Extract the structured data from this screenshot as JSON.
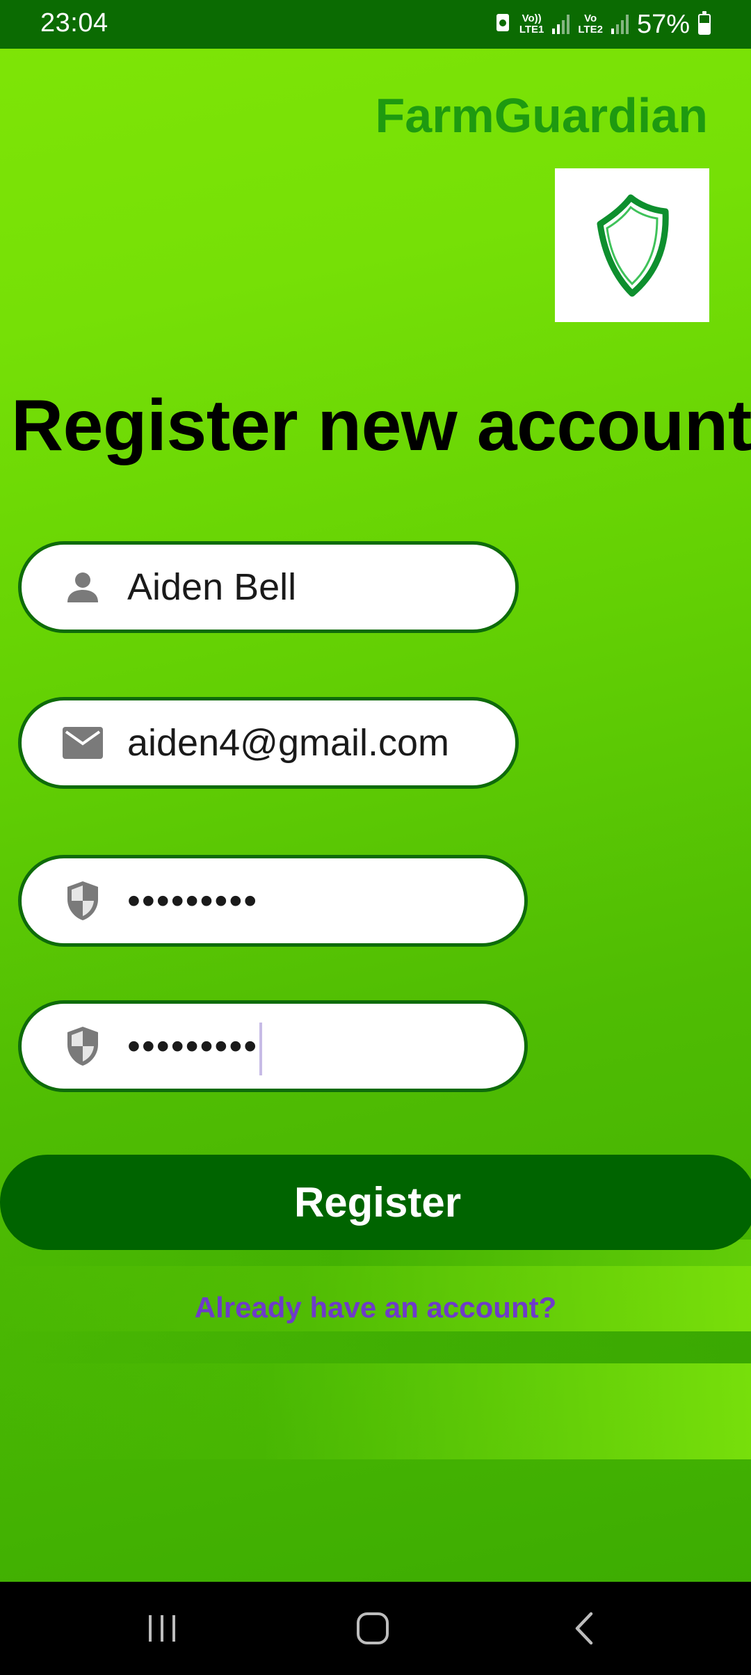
{
  "status_bar": {
    "time": "23:04",
    "sim1_label": "Vo)) LTE1",
    "sim2_label": "Vo LTE2",
    "battery": "57%"
  },
  "app": {
    "title": "FarmGuardian",
    "logo_icon": "green-shield-icon",
    "brand_color": "#1e9a10"
  },
  "page": {
    "heading": "Register new account"
  },
  "form": {
    "name": {
      "icon": "person-icon",
      "value": "Aiden Bell"
    },
    "email": {
      "icon": "mail-icon",
      "value": "aiden4@gmail.com"
    },
    "password": {
      "icon": "security-shield-icon",
      "value": "•••••••••"
    },
    "confirm_password": {
      "icon": "security-shield-icon",
      "value": "•••••••••"
    },
    "field_border_color": "#0e6b0a"
  },
  "actions": {
    "register_label": "Register",
    "register_color": "#006400",
    "login_link": "Already have an account?",
    "login_link_color": "#6e3bc9"
  },
  "nav": {
    "recent_icon": "recent-apps-icon",
    "home_icon": "home-icon",
    "back_icon": "back-icon"
  }
}
